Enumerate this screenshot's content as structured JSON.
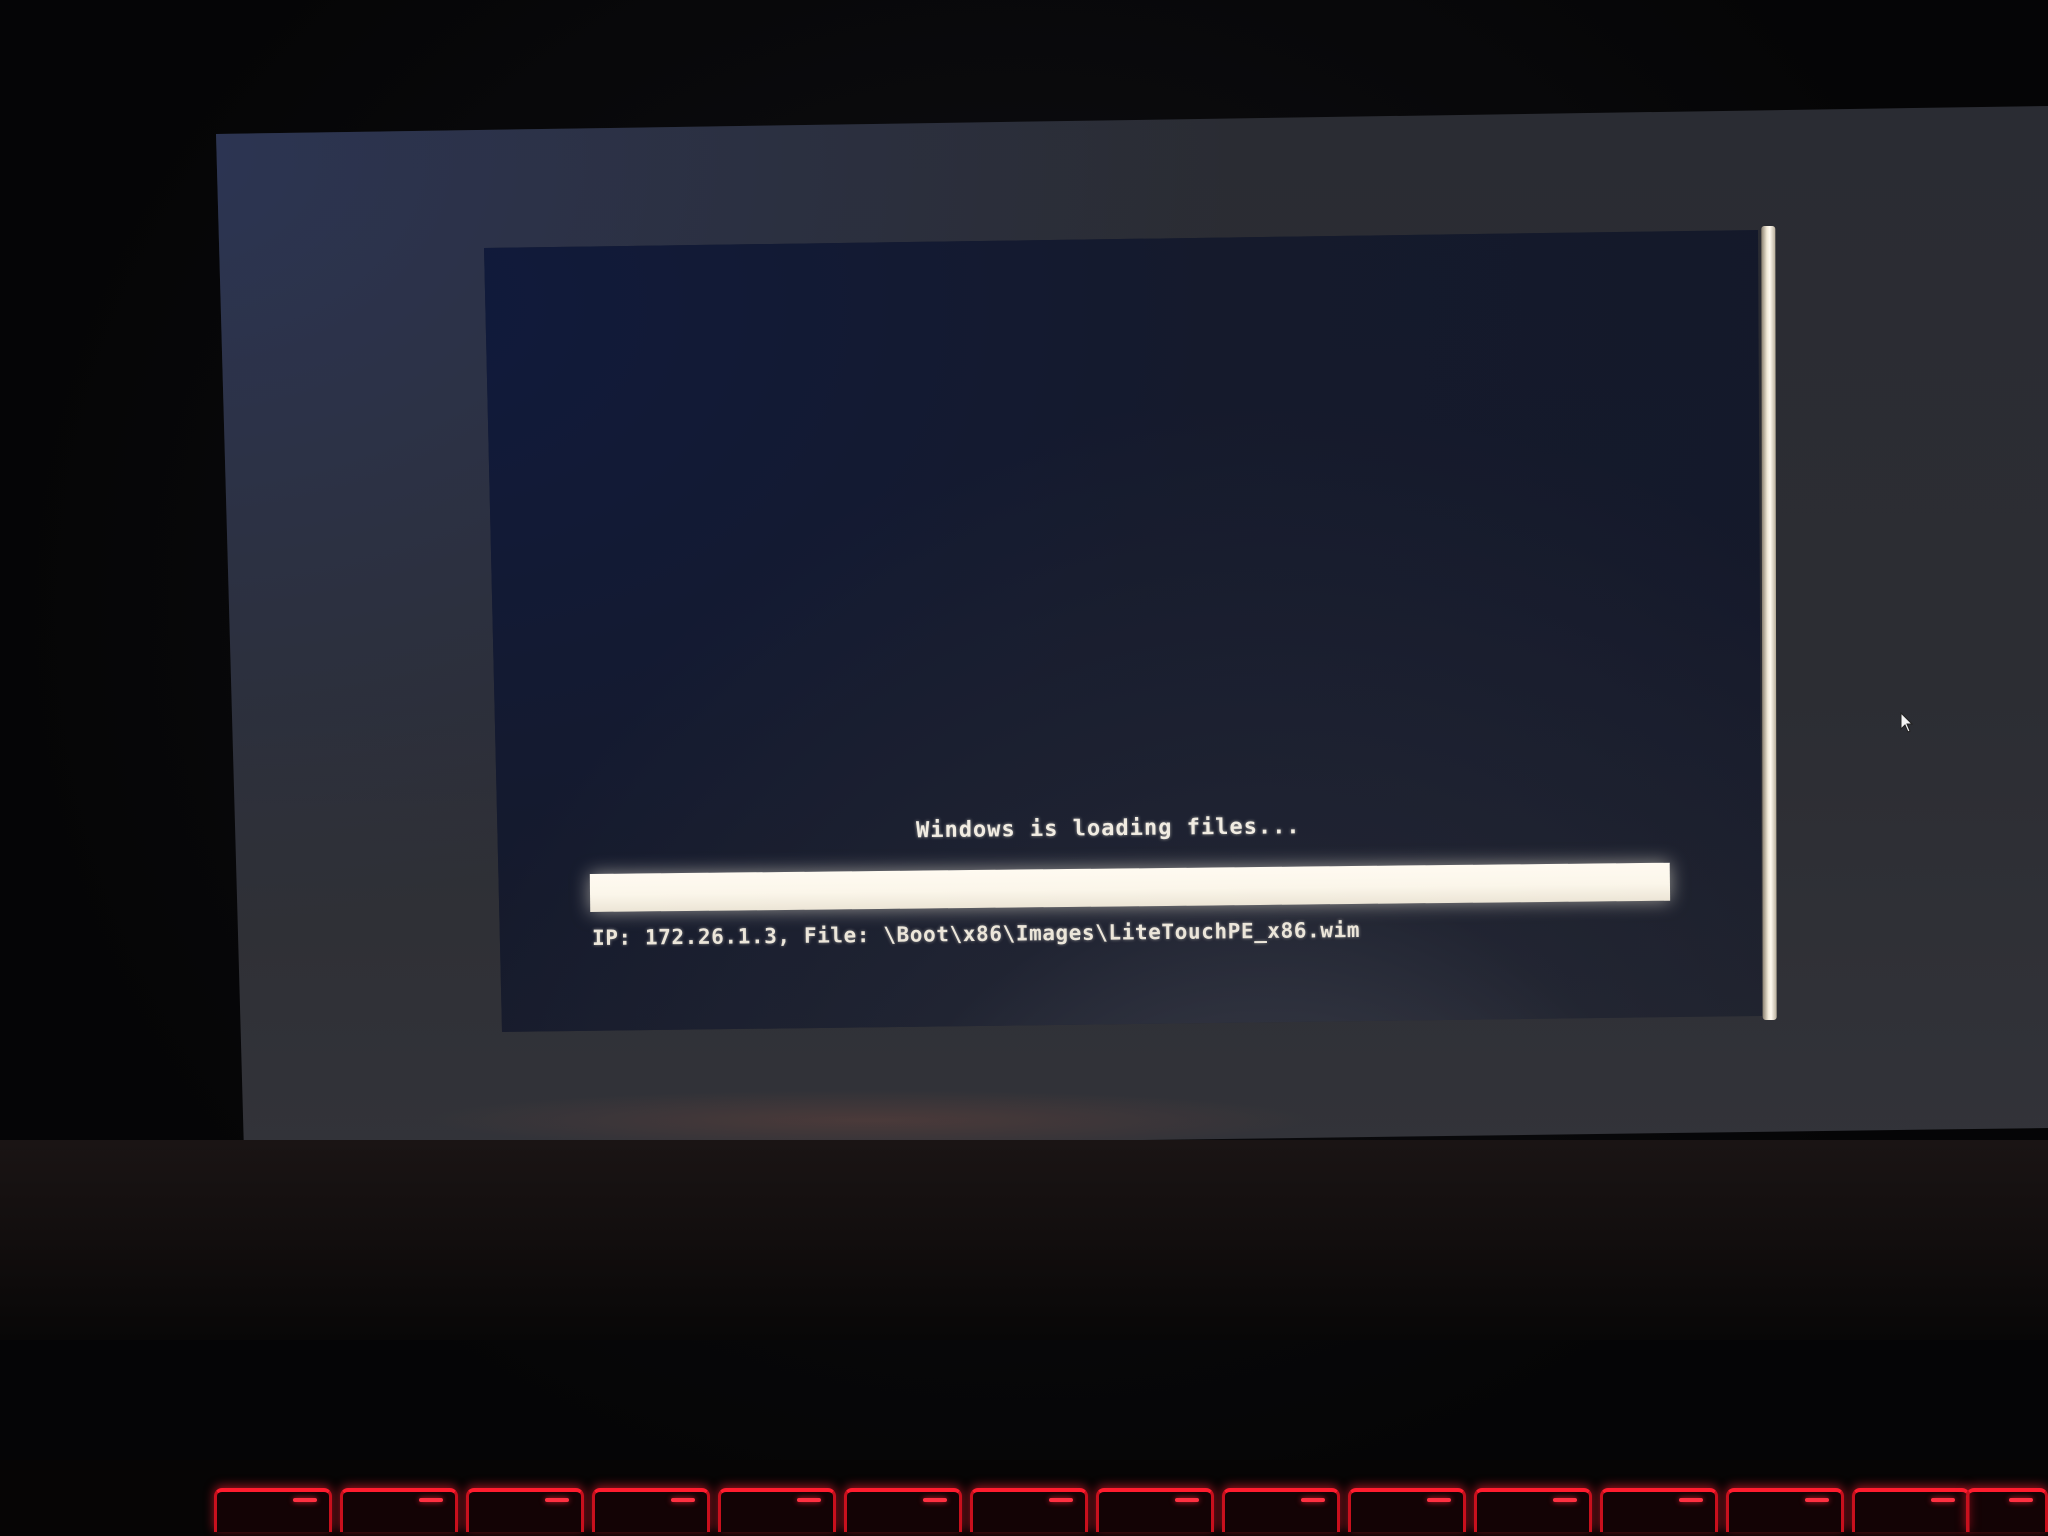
{
  "boot_screen": {
    "message": "Windows is loading files...",
    "progress_fraction": 1.0,
    "status_line": "IP: 172.26.1.3, File: \\Boot\\x86\\Images\\LiteTouchPE_x86.wim"
  },
  "colors": {
    "text": "#f1ece2",
    "progress_fill": "#fbf6ea",
    "screen_background": "#15192a",
    "keyboard_backlight": "#ff1c2e"
  },
  "icons": {
    "pointer": "mouse-pointer-icon"
  }
}
